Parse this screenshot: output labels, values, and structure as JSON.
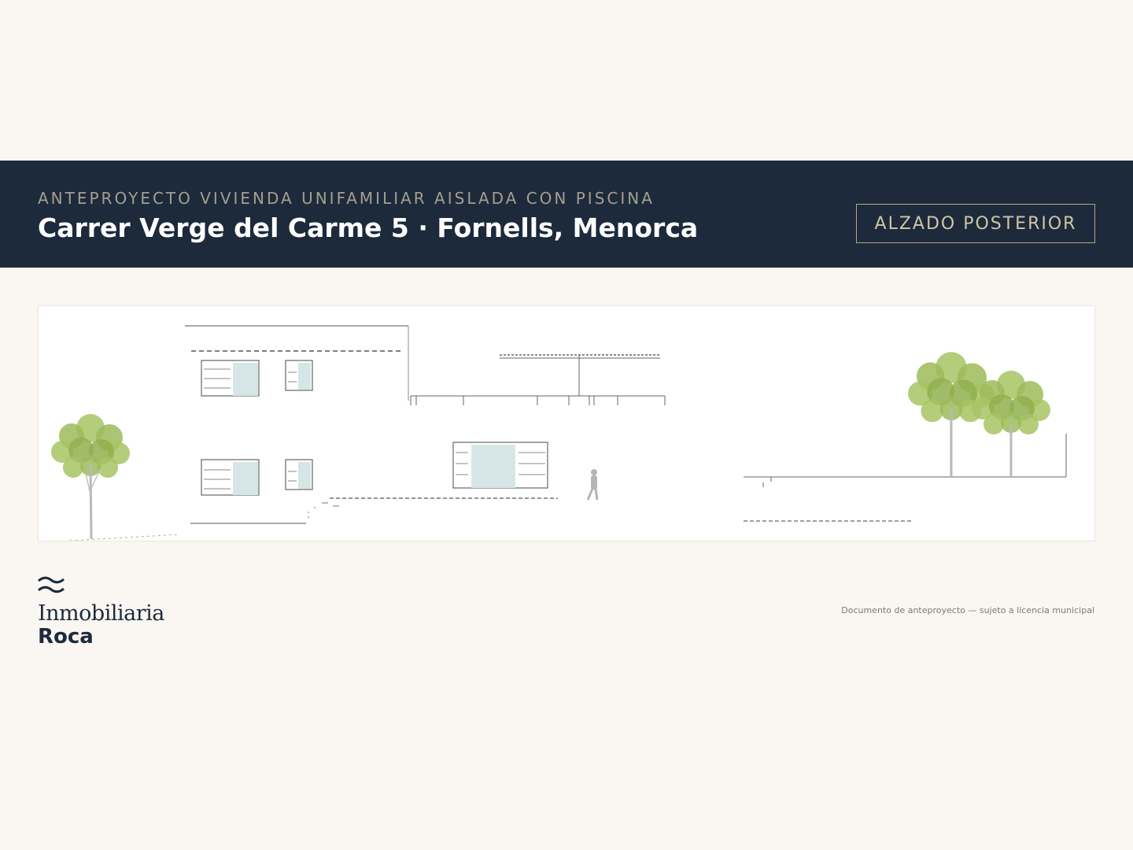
{
  "header": {
    "subtitle": "ANTEPROYECTO VIVIENDA UNIFAMILIAR AISLADA CON PISCINA",
    "title": "Carrer Verge del Carme 5 · Fornells, Menorca",
    "badge": "ALZADO POSTERIOR"
  },
  "drawing": {
    "view": "rear elevation drawing",
    "icons": [
      "tree-icon",
      "person-silhouette-icon"
    ]
  },
  "brand": {
    "mark": "≈",
    "name": "Inmobiliaria",
    "name_bold": "Roca"
  },
  "footer": {
    "disclaimer": "Documento de anteproyecto — sujeto a licencia municipal"
  },
  "colors": {
    "background": "#faf7f2",
    "header_bg": "#1c2a3c",
    "accent_gold": "#b8a97c",
    "tree_green": "#9cbb5a",
    "glass": "#d6e6e6"
  }
}
